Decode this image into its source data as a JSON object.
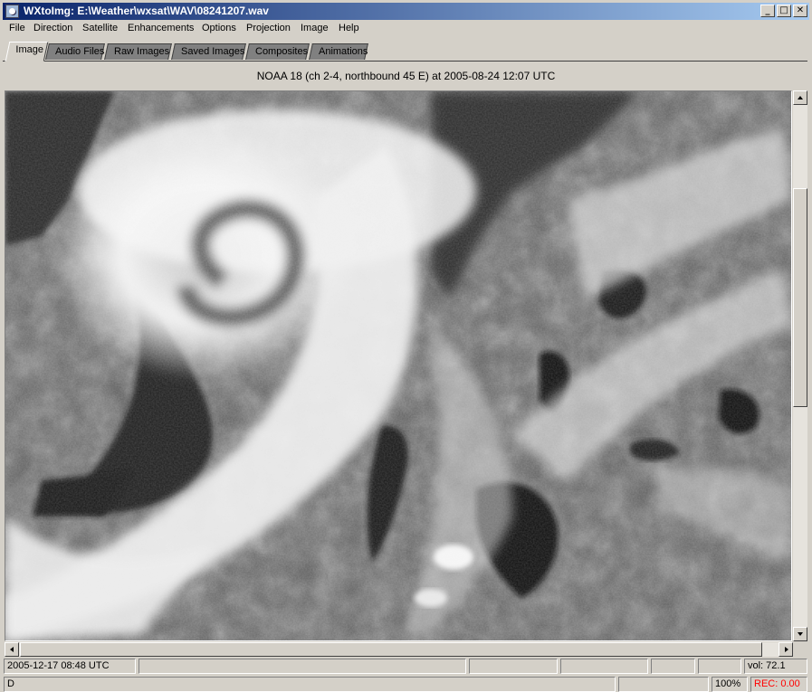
{
  "window": {
    "title": "WXtoImg: E:\\Weather\\wxsat\\WAV\\08241207.wav",
    "minimize_glyph": "_",
    "maximize_glyph": "□",
    "close_glyph": "✕"
  },
  "menu": {
    "items": [
      "File",
      "Direction",
      "Satellite",
      "Enhancements",
      "Options",
      "Projection",
      "Image",
      "Help"
    ]
  },
  "tabs": {
    "items": [
      "Image",
      "Audio Files",
      "Raw Images",
      "Saved Images",
      "Composites",
      "Animations"
    ],
    "active": "Image"
  },
  "image": {
    "caption": "NOAA 18 (ch 2-4, northbound 45 E) at 2005-08-24  12:07 UTC"
  },
  "status": {
    "datetime": "2005-12-17  08:48 UTC",
    "volume": "vol: 72.1",
    "bottom_left": "D",
    "zoom": "100%",
    "rec": "REC: 0.00"
  },
  "colors": {
    "titlebar_start": "#0a246a",
    "titlebar_end": "#a6caf0",
    "chrome": "#d4d0c8",
    "rec_text": "#ff0000"
  }
}
